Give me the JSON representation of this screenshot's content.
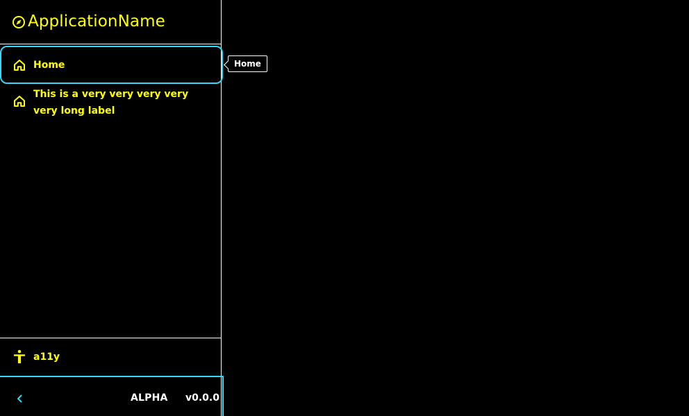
{
  "app": {
    "name": "ApplicationName"
  },
  "sidebar": {
    "items": [
      {
        "label": "Home",
        "icon": "home-icon"
      },
      {
        "label": "This is a very very very very very long label",
        "icon": "home-icon"
      }
    ],
    "bottom_item": {
      "label": "a11y",
      "icon": "accessibility-icon"
    },
    "footer": {
      "collapse_icon": "chevron-left-icon",
      "stage": "ALPHA",
      "version": "v0.0.0"
    }
  },
  "tooltip": {
    "text": "Home"
  },
  "colors": {
    "background": "#000000",
    "text_accent": "#ffff00",
    "focus": "#36d7f7",
    "border": "#ffffff",
    "secondary_text": "#ffffff"
  }
}
